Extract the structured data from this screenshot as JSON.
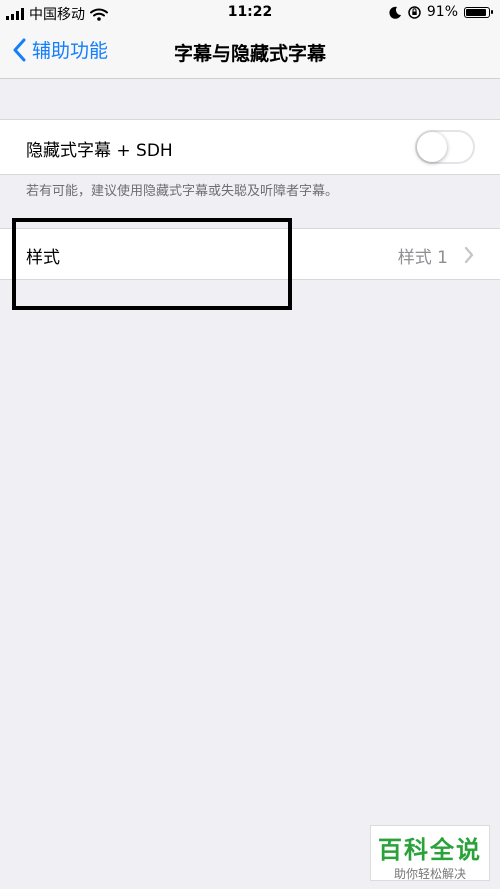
{
  "status_bar": {
    "carrier": "中国移动",
    "time": "11:22",
    "battery_percent": "91%",
    "battery_level": 0.91,
    "icons": [
      "signal-icon",
      "wifi-icon",
      "moon-icon",
      "orientation-lock-icon",
      "battery-icon"
    ]
  },
  "nav": {
    "back_label": "辅助功能",
    "title": "字幕与隐藏式字幕"
  },
  "settings": {
    "sdh_label": "隐藏式字幕 + SDH",
    "sdh_enabled": false,
    "footnote": "若有可能，建议使用隐藏式字幕或失聪及听障者字幕。",
    "style_label": "样式",
    "style_value": "样式 1"
  },
  "watermark": {
    "logo": "百科全说",
    "tagline": "助你轻松解决"
  },
  "colors": {
    "accent": "#147efb",
    "background": "#efeff4",
    "secondary_text": "#8e8e93"
  }
}
